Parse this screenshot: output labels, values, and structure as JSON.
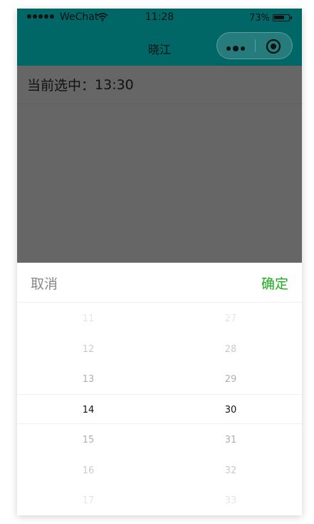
{
  "status_bar": {
    "carrier": "WeChat",
    "time": "11:28",
    "battery_percent": "73%",
    "battery_level": 0.73,
    "signal_icon": "signal-dots-icon",
    "wifi_icon": "wifi-icon",
    "battery_icon": "battery-icon"
  },
  "nav": {
    "title": "晓江",
    "background": "#006666",
    "menu_icon": "more-dots-icon",
    "close_icon": "target-circle-icon"
  },
  "page": {
    "selected_label": "当前选中：",
    "selected_value": "13:30",
    "background": "#666666"
  },
  "picker": {
    "cancel_label": "取消",
    "confirm_label": "确定",
    "confirm_color": "#1aad19",
    "hours": [
      "11",
      "12",
      "13",
      "14",
      "15",
      "16",
      "17"
    ],
    "minutes": [
      "27",
      "28",
      "29",
      "30",
      "31",
      "32",
      "33"
    ],
    "selected_hour": "14",
    "selected_minute": "30"
  }
}
